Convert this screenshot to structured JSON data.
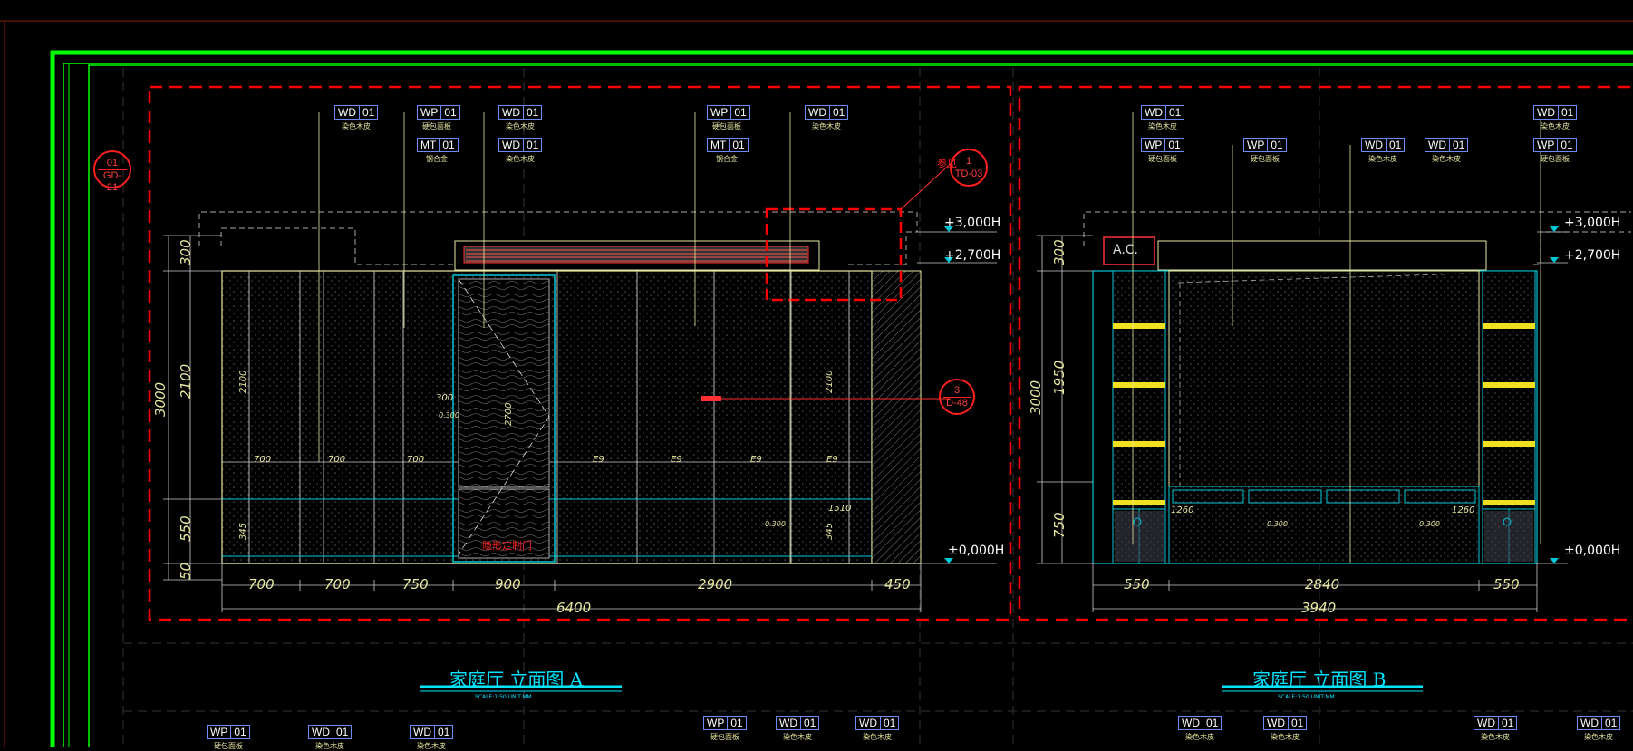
{
  "colors": {
    "background": "#000000",
    "border": "#00ff00",
    "red_dashed": "#ff0000",
    "cyan": "#00e5ff",
    "yellow": "#e8e8a0",
    "tag_border": "#6a8cff"
  },
  "elevation_a": {
    "title": "家庭厅  立面图 A",
    "scale": "SCALE:1:50  UNIT:MM",
    "levels": [
      "+3,000H",
      "+2,700H",
      "±0,000H"
    ],
    "bottom_dims": [
      "700",
      "700",
      "750",
      "900",
      "2900",
      "450"
    ],
    "total_dim": "6400",
    "left_dims": [
      "300",
      "2100",
      "550",
      "50",
      "3000"
    ],
    "inner_dims": [
      "2100",
      "2100",
      "2700",
      "700",
      "700",
      "700",
      "E9",
      "E9",
      "E9",
      "E9",
      "1510",
      "345",
      "345",
      "300",
      "0.300",
      "0.300"
    ],
    "door_label": "隐形定制门",
    "tags_top": [
      {
        "code": "WD",
        "num": "01",
        "desc": "染色木皮"
      },
      {
        "code": "WP",
        "num": "01",
        "desc": "硬包面板"
      },
      {
        "code": "MT",
        "num": "01",
        "desc": "钢合金"
      },
      {
        "code": "WD",
        "num": "01",
        "desc": "染色木皮"
      },
      {
        "code": "WD",
        "num": "01",
        "desc": "染色木皮"
      },
      {
        "code": "WP",
        "num": "01",
        "desc": "硬包面板"
      },
      {
        "code": "MT",
        "num": "01",
        "desc": "钢合金"
      },
      {
        "code": "WD",
        "num": "01",
        "desc": "染色木皮"
      }
    ],
    "bubble_left": {
      "top": "01",
      "bottom": "GD-21"
    },
    "bubble_right": {
      "top": "1",
      "bottom": "TD-03"
    },
    "bubble_mid": {
      "top": "3",
      "bottom": "D-48"
    },
    "note_left": "参见"
  },
  "elevation_b": {
    "title": "家庭厅  立面图 B",
    "scale": "SCALE:1:50  UNIT:MM",
    "levels": [
      "+3,000H",
      "+2,700H",
      "±0,000H"
    ],
    "bottom_dims": [
      "550",
      "2840",
      "550"
    ],
    "total_dim": "3940",
    "left_dims": [
      "300",
      "1950",
      "750",
      "3000"
    ],
    "inner_dims": [
      "1260",
      "1260",
      "0.300",
      "0.300"
    ],
    "ac_label": "A.C.",
    "tags_top": [
      {
        "code": "WD",
        "num": "01",
        "desc": "染色木皮"
      },
      {
        "code": "WP",
        "num": "01",
        "desc": "硬包面板"
      },
      {
        "code": "WP",
        "num": "01",
        "desc": "硬包面板"
      },
      {
        "code": "WD",
        "num": "01",
        "desc": "染色木皮"
      },
      {
        "code": "WD",
        "num": "01",
        "desc": "染色木皮"
      },
      {
        "code": "WD",
        "num": "01",
        "desc": "染色木皮"
      },
      {
        "code": "WP",
        "num": "01",
        "desc": "硬包面板"
      }
    ]
  },
  "bottom_tags": [
    {
      "code": "WP",
      "num": "01",
      "desc": "硬包面板"
    },
    {
      "code": "WD",
      "num": "01",
      "desc": "染色木皮"
    },
    {
      "code": "WD",
      "num": "01",
      "desc": "染色木皮"
    },
    {
      "code": "WP",
      "num": "01",
      "desc": "硬包面板"
    },
    {
      "code": "WD",
      "num": "01",
      "desc": "染色木皮"
    },
    {
      "code": "WD",
      "num": "01",
      "desc": "染色木皮"
    },
    {
      "code": "WD",
      "num": "01",
      "desc": "染色木皮"
    },
    {
      "code": "WD",
      "num": "01",
      "desc": "染色木皮"
    },
    {
      "code": "WD",
      "num": "01",
      "desc": "染色木皮"
    },
    {
      "code": "WD",
      "num": "01",
      "desc": "染色木皮"
    }
  ]
}
